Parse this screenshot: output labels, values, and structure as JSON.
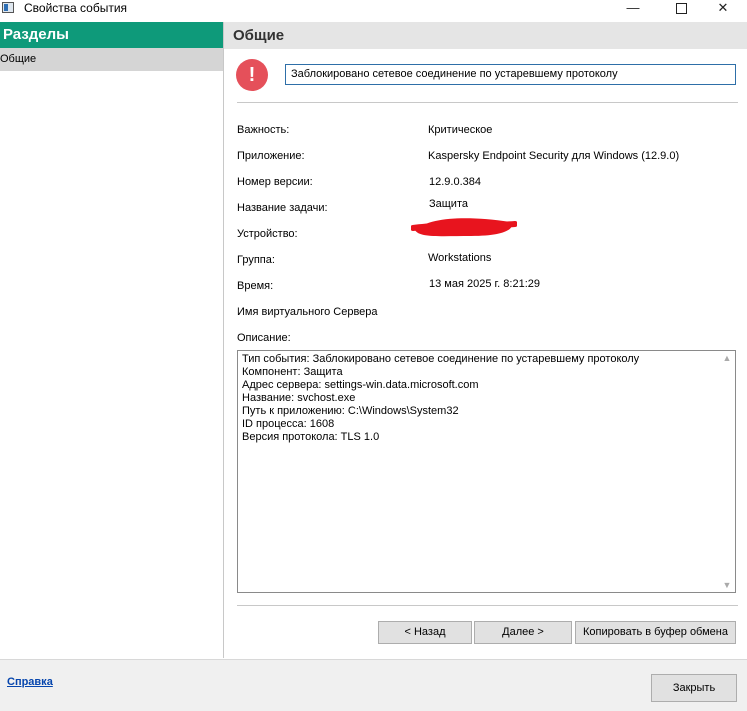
{
  "window": {
    "title": "Свойства события",
    "minimize_glyph": "—",
    "close_glyph": "✕"
  },
  "sidebar": {
    "header": "Разделы",
    "items": [
      {
        "label": "Общие"
      }
    ]
  },
  "main": {
    "header": "Общие",
    "alert_icon": "exclamation-icon",
    "alert_glyph": "!",
    "summary": "Заблокировано сетевое соединение по устаревшему протоколу",
    "fields": {
      "severity_label": "Важность:",
      "severity_value": "Критическое",
      "app_label": "Приложение:",
      "app_value": "Kaspersky Endpoint Security для Windows (12.9.0)",
      "version_label": "Номер версии:",
      "version_value": "12.9.0.384",
      "task_label": "Название задачи:",
      "task_value": "Защита",
      "device_label": "Устройство:",
      "group_label": "Группа:",
      "group_value": "Workstations",
      "time_label": "Время:",
      "time_value": "13 мая 2025 г. 8:21:29",
      "vserver_label": "Имя виртуального Сервера",
      "description_label": "Описание:"
    },
    "description": "Тип события: Заблокировано сетевое соединение по устаревшему протоколу\nКомпонент: Защита\nАдрес сервера: settings-win.data.microsoft.com\nНазвание: svchost.exe\nПуть к приложению: C:\\Windows\\System32\nID процесса: 1608\nВерсия протокола: TLS 1.0",
    "buttons": {
      "back": "< Назад",
      "next": "Далее >",
      "copy": "Копировать в буфер обмена"
    }
  },
  "footer": {
    "help_link": "Справка",
    "close_button": "Закрыть"
  },
  "colors": {
    "sidebar_header": "#0e9a7a",
    "alert": "#e5505a",
    "summary_border": "#2e6fa8",
    "redaction": "#e8141e"
  }
}
